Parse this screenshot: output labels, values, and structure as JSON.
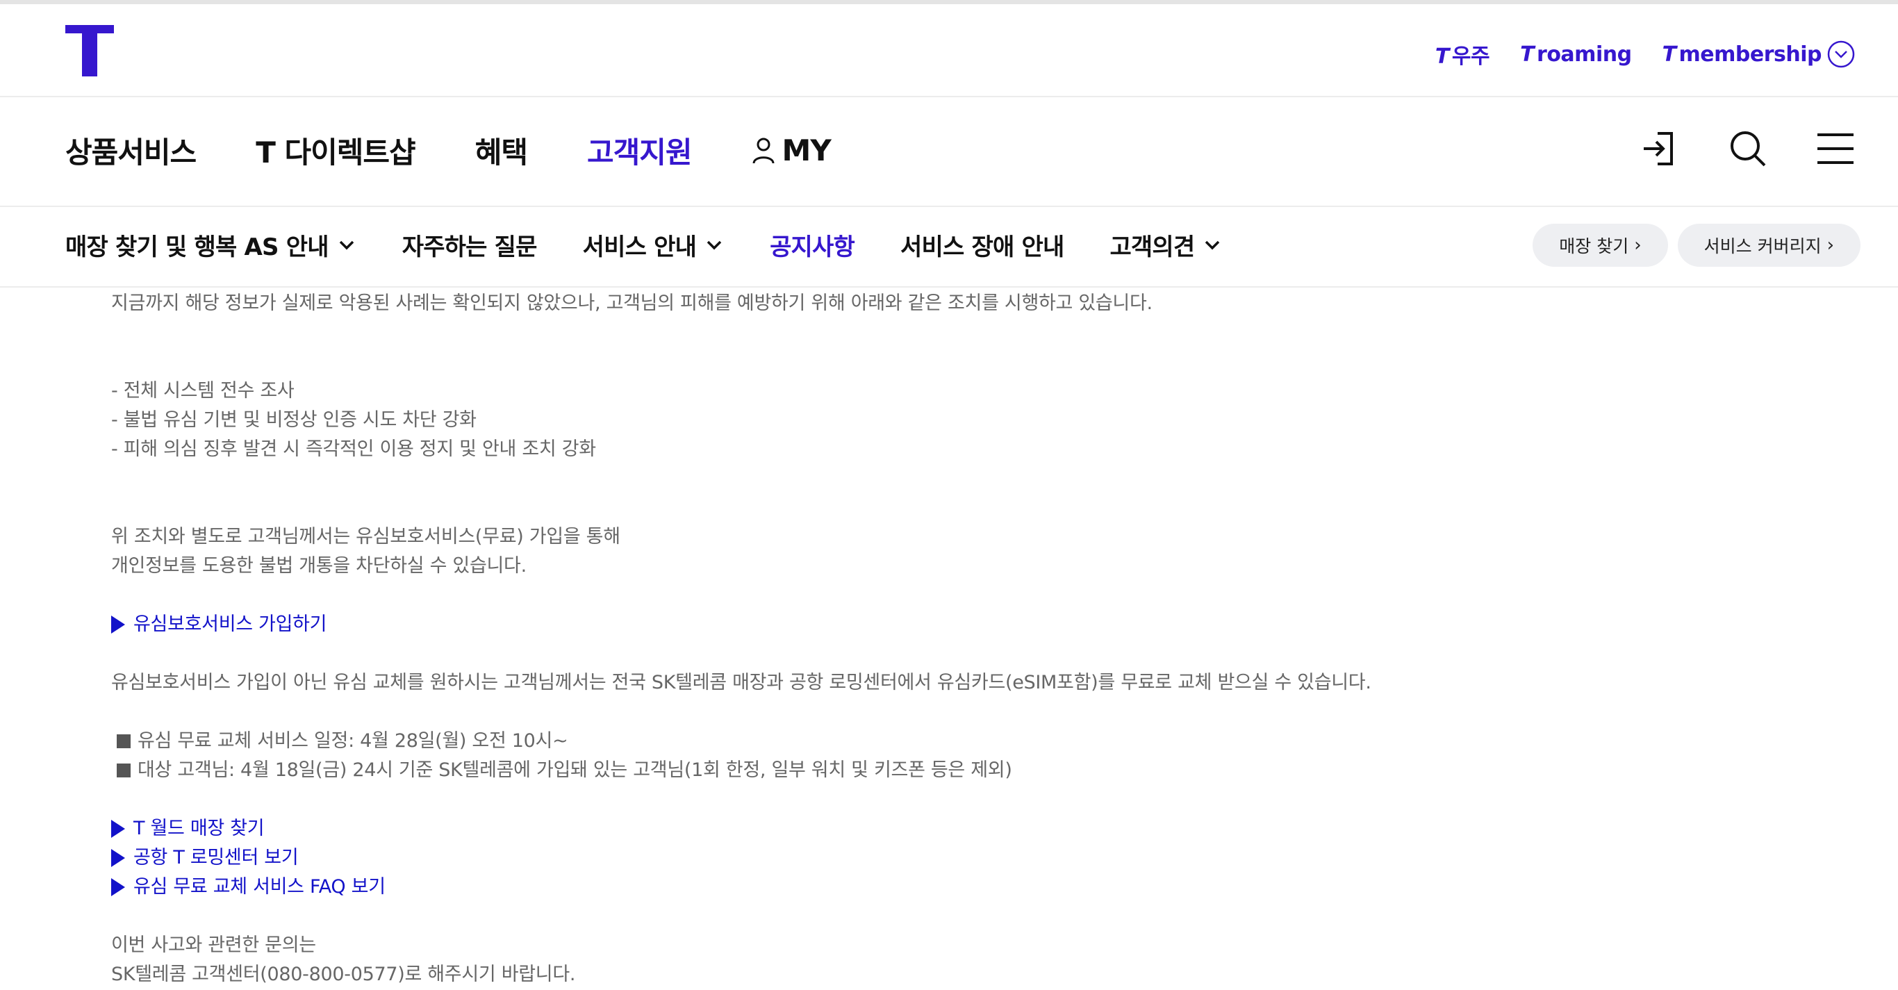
{
  "brand": {
    "logo_label": "T",
    "accent_color": "#3617ce",
    "link_color": "#1212c9"
  },
  "util": {
    "links": [
      {
        "prefix": "T",
        "label": "우주"
      },
      {
        "prefix": "T",
        "label": "roaming"
      },
      {
        "prefix": "T",
        "label": "membership"
      }
    ],
    "more_icon": "chevron-down-circle-icon"
  },
  "gnb": {
    "items": [
      "상품서비스",
      "T 다이렉트샵",
      "혜택",
      "고객지원",
      "MY"
    ],
    "active": "고객지원",
    "icons": [
      "login-icon",
      "search-icon",
      "menu-icon"
    ]
  },
  "lnb": {
    "items": [
      {
        "label": "매장 찾기 및 행복 AS 안내",
        "dropdown": true
      },
      {
        "label": "자주하는 질문",
        "dropdown": false
      },
      {
        "label": "서비스 안내",
        "dropdown": true
      },
      {
        "label": "공지사항",
        "dropdown": false,
        "active": true
      },
      {
        "label": "서비스 장애 안내",
        "dropdown": false
      },
      {
        "label": "고객의견",
        "dropdown": true
      }
    ],
    "pills": [
      "매장 찾기",
      "서비스 커버리지"
    ],
    "pill_arrow": "›"
  },
  "content": {
    "intro": "지금까지 해당 정보가 실제로 악용된 사례는 확인되지 않았으나, 고객님의 피해를 예방하기 위해 아래와 같은 조치를 시행하고 있습니다.",
    "measures": [
      "- 전체 시스템 전수 조사",
      "- 불법 유심 기변 및 비정상 인증 시도 차단 강화",
      "- 피해 의심 징후 발견 시 즉각적인 이용 정지 및 안내 조치 강화"
    ],
    "protect_1": "위 조치와 별도로 고객님께서는 유심보호서비스(무료) 가입을 통해",
    "protect_2": "개인정보를 도용한 불법 개통을 차단하실 수 있습니다.",
    "protect_link": "유심보호서비스 가입하기",
    "exchange": "유심보호서비스 가입이 아닌 유심 교체를 원하시는 고객님께서는 전국 SK텔레콤 매장과 공항 로밍센터에서 유심카드(eSIM포함)를 무료로 교체 받으실 수 있습니다.",
    "schedule": "유심 무료 교체 서비스 일정: 4월 28일(월) 오전 10시~",
    "target": "대상 고객님: 4월 18일(금) 24시 기준 SK텔레콤에 가입돼 있는 고객님(1회 한정, 일부 워치 및 키즈폰 등은 제외)",
    "links": [
      "T 월드 매장 찾기",
      "공항 T 로밍센터 보기",
      "유심 무료 교체 서비스 FAQ 보기"
    ],
    "contact_1": "이번 사고와 관련한 문의는",
    "contact_2": "SK텔레콤 고객센터(080-800-0577)로 해주시기 바랍니다."
  }
}
